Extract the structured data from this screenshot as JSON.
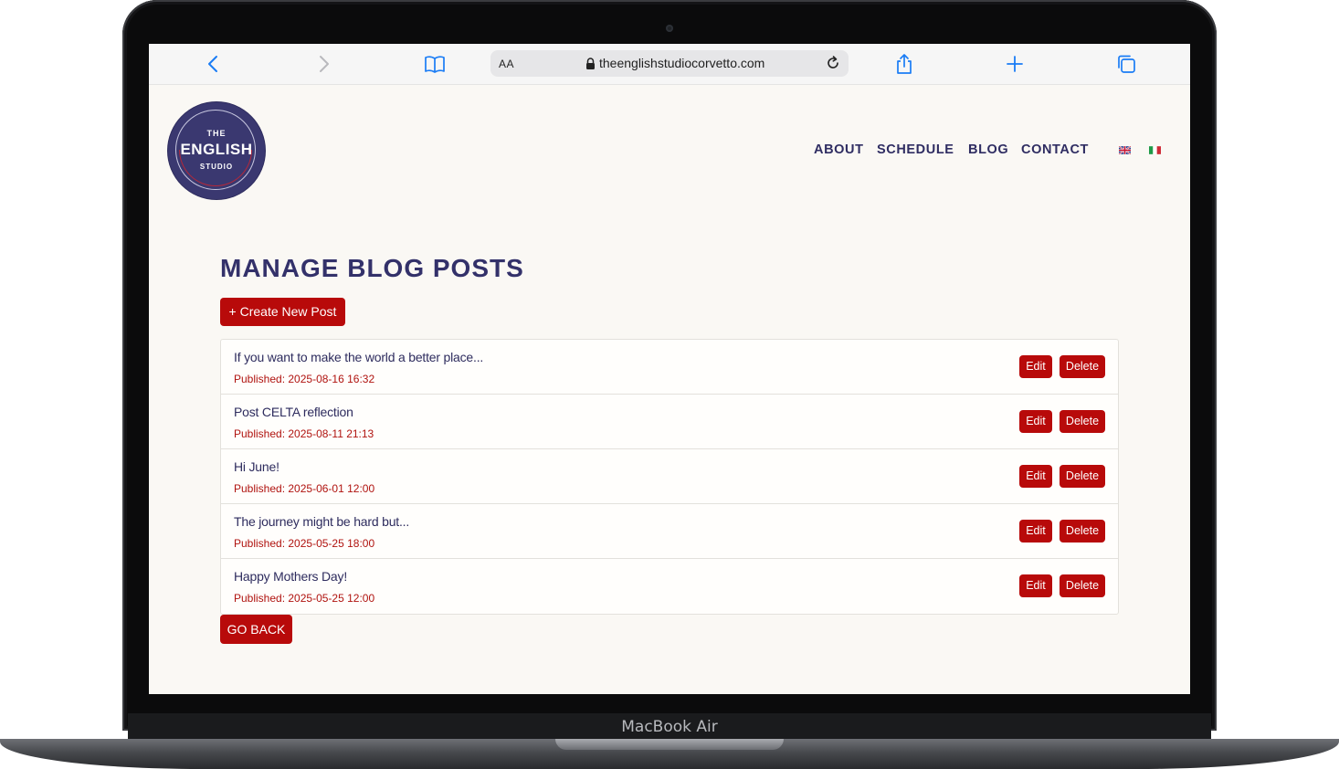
{
  "device": {
    "model_label": "MacBook Air"
  },
  "browser": {
    "reader_label": "AA",
    "url": "theenglishstudiocorvetto.com"
  },
  "site": {
    "logo": {
      "line1": "THE",
      "line2": "ENGLISH",
      "line3": "STUDIO"
    },
    "nav": [
      {
        "label": "ABOUT"
      },
      {
        "label": "SCHEDULE"
      },
      {
        "label": "BLOG"
      },
      {
        "label": "CONTACT"
      }
    ],
    "languages": [
      "en-flag-icon",
      "it-flag-icon"
    ]
  },
  "main": {
    "title": "MANAGE BLOG POSTS",
    "create_label": "+ Create New Post",
    "edit_label": "Edit",
    "delete_label": "Delete",
    "back_label": "GO BACK",
    "posts": [
      {
        "title": "If you want to make the world a better place...",
        "published": "Published: 2025-08-16 16:32"
      },
      {
        "title": "Post CELTA reflection",
        "published": "Published: 2025-08-11 21:13"
      },
      {
        "title": "Hi June!",
        "published": "Published: 2025-06-01 12:00"
      },
      {
        "title": "The journey might be hard but...",
        "published": "Published: 2025-05-25 18:00"
      },
      {
        "title": "Happy Mothers Day!",
        "published": "Published: 2025-05-25 12:00"
      }
    ]
  },
  "colors": {
    "brand_navy": "#33316a",
    "brand_red": "#b80a0a",
    "page_bg": "#faf8f4",
    "safari_blue": "#1a7cf5"
  }
}
